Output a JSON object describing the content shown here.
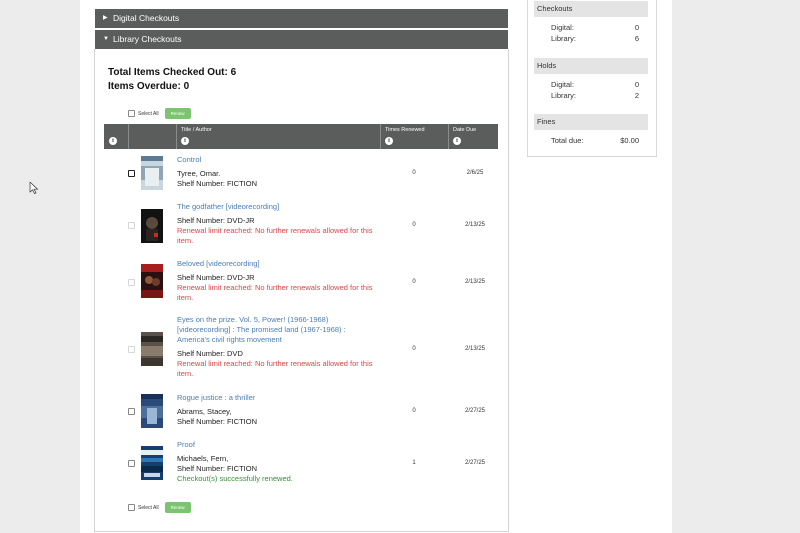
{
  "panels": {
    "digital_label": "Digital Checkouts",
    "library_label": "Library Checkouts"
  },
  "summary": {
    "total_text": "Total Items Checked Out: 6",
    "overdue_text": "Items Overdue: 0"
  },
  "controls": {
    "select_all_label": "Select All",
    "renew_label": "Renew"
  },
  "table": {
    "headers": {
      "title_author": "Title / Author",
      "times_renewed": "Times Renewed",
      "date_due": "Date Due"
    },
    "rows": [
      {
        "title": "Control",
        "author": "Tyree, Omar.",
        "shelf": "Shelf Number: FICTION",
        "status": "",
        "renewed": "0",
        "due": "2/6/25"
      },
      {
        "title": "The godfather [videorecording]",
        "author": "",
        "shelf": "Shelf Number: DVD-JR",
        "status": "Renewal limit reached: No further renewals allowed for this item.",
        "renewed": "0",
        "due": "2/13/25"
      },
      {
        "title": "Beloved [videorecording]",
        "author": "",
        "shelf": "Shelf Number: DVD-JR",
        "status": "Renewal limit reached: No further renewals allowed for this item.",
        "renewed": "0",
        "due": "2/13/25"
      },
      {
        "title": "Eyes on the prize. Vol. 5, Power! (1966-1968) [videorecording] : The promised land (1967-1968) : America's civil rights movement",
        "author": "",
        "shelf": "Shelf Number: DVD",
        "status": "Renewal limit reached: No further renewals allowed for this item.",
        "renewed": "0",
        "due": "2/13/25"
      },
      {
        "title": "Rogue justice : a thriller",
        "author": "Abrams, Stacey,",
        "shelf": "Shelf Number: FICTION",
        "status": "",
        "renewed": "0",
        "due": "2/27/25"
      },
      {
        "title": "Proof",
        "author": "Michaels, Fern,",
        "shelf": "Shelf Number: FICTION",
        "status": "Checkout(s) successfully renewed.",
        "renewed": "1",
        "due": "2/27/25"
      }
    ]
  },
  "sidebar": {
    "checkouts": {
      "heading": "Checkouts",
      "digital_label": "Digital:",
      "digital_value": "0",
      "library_label": "Library:",
      "library_value": "6"
    },
    "holds": {
      "heading": "Holds",
      "digital_label": "Digital:",
      "digital_value": "0",
      "library_label": "Library:",
      "library_value": "2"
    },
    "fines": {
      "heading": "Fines",
      "total_label": "Total due:",
      "total_value": "$0.00"
    }
  },
  "colors": {
    "header_bar": "#5a5d5c",
    "link": "#4a7eb5",
    "error": "#d9474a",
    "success": "#3a8f37",
    "renew_button": "#7dc470"
  },
  "icons": {
    "collapsed": "caret-right-icon",
    "expanded": "caret-down-icon",
    "sort": "sort-icon"
  }
}
